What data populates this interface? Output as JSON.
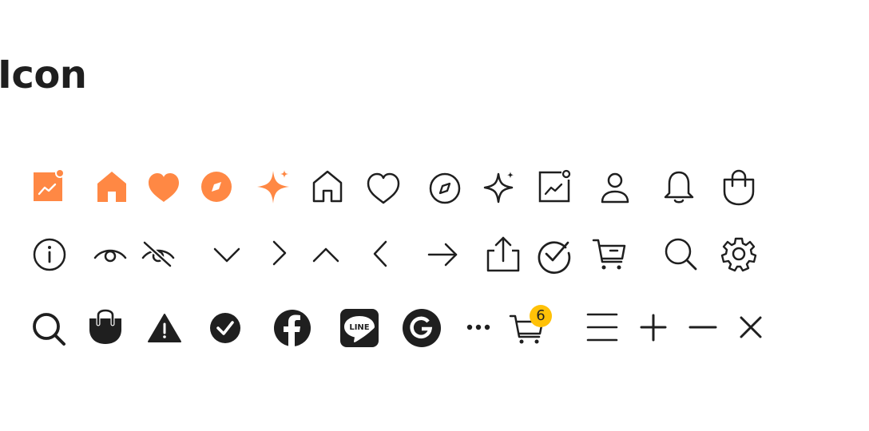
{
  "title": "Icon",
  "colors": {
    "accent": "#ff8844",
    "ink": "#1f1f1f",
    "badge": "#ffc107"
  },
  "icon_rows": [
    [
      "chart-filled",
      "home-filled",
      "heart-filled",
      "compass-filled",
      "sparkle-filled",
      "home-outline",
      "heart-outline",
      "compass-outline",
      "sparkle-outline",
      "chart-outline",
      "user-outline",
      "bell-outline",
      "bag-outline"
    ],
    [
      "info",
      "eye",
      "eye-off",
      "chevron-down",
      "chevron-right",
      "chevron-up",
      "chevron-left",
      "arrow-right",
      "share",
      "check-circle",
      "cart-remove",
      "search",
      "gear"
    ],
    [
      "search-bold",
      "bag-filled",
      "warning-filled",
      "check-circle-filled",
      "facebook",
      "line",
      "google",
      "more-dots",
      "cart-badge",
      "menu",
      "plus",
      "minus",
      "close"
    ]
  ],
  "cart_badge_count": "6"
}
